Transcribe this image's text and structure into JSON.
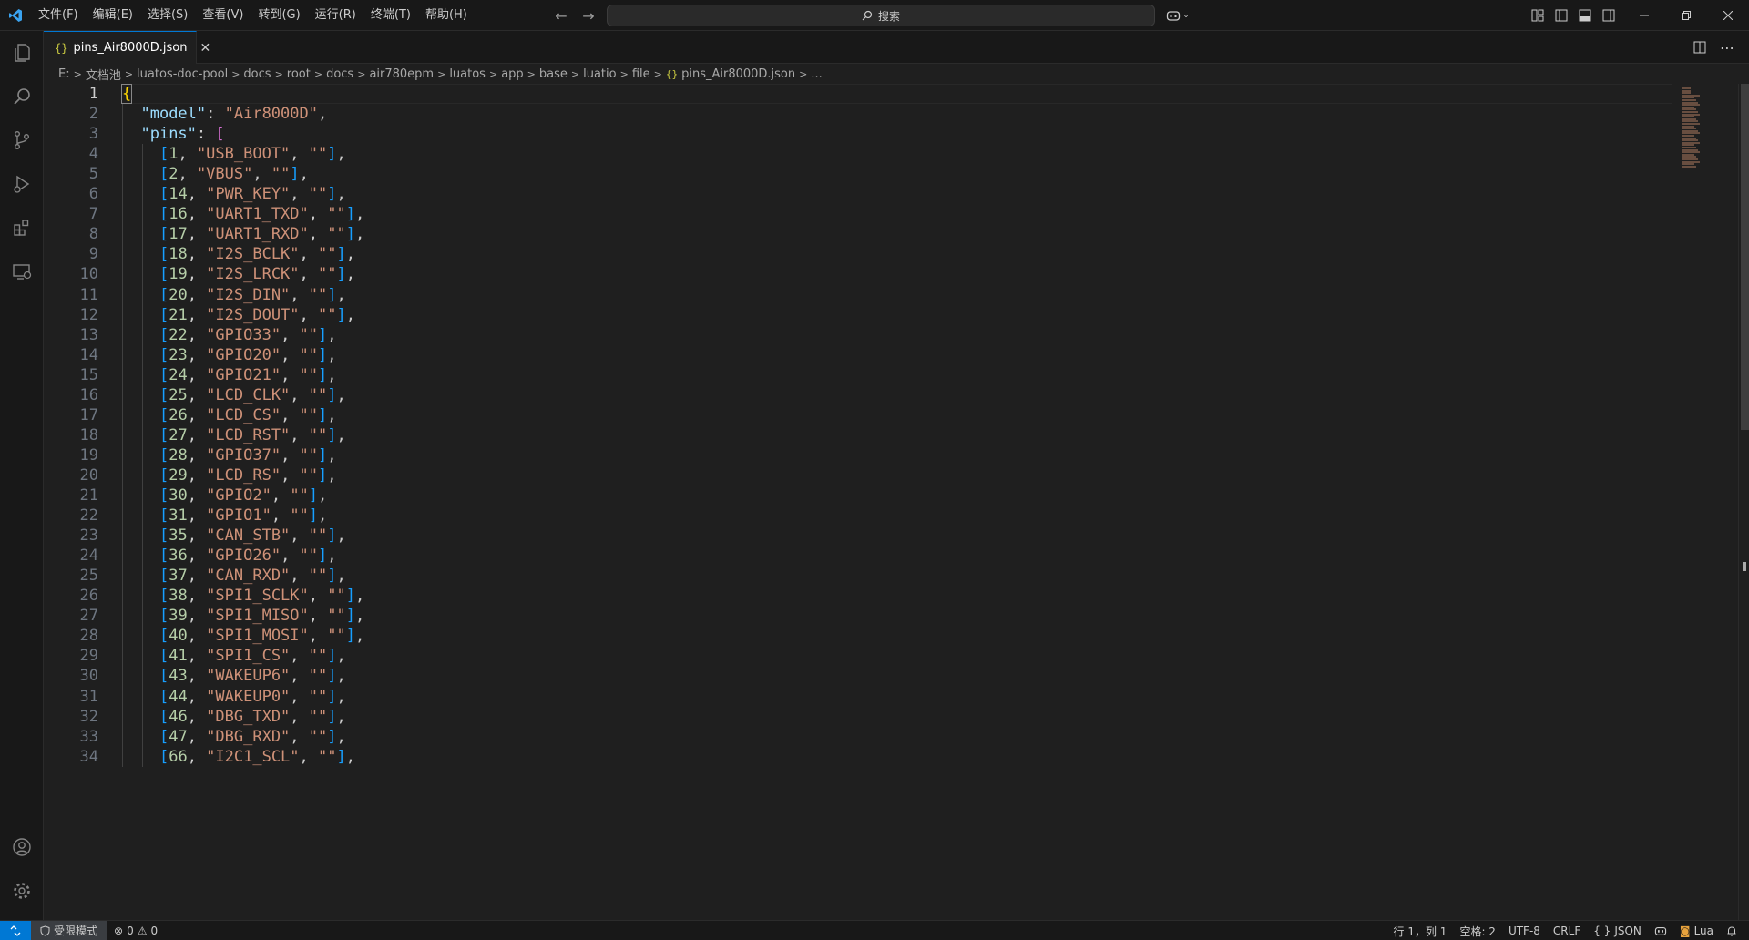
{
  "menu": [
    "文件(F)",
    "编辑(E)",
    "选择(S)",
    "查看(V)",
    "转到(G)",
    "运行(R)",
    "终端(T)",
    "帮助(H)"
  ],
  "search": {
    "label": "搜索"
  },
  "tab": {
    "title": "pins_Air8000D.json",
    "icon": "{}"
  },
  "breadcrumbs": [
    "E:",
    "文档池",
    "luatos-doc-pool",
    "docs",
    "root",
    "docs",
    "air780epm",
    "luatos",
    "app",
    "base",
    "luatio",
    "file",
    "pins_Air8000D.json",
    "..."
  ],
  "lines": [
    {
      "n": "1"
    },
    {
      "n": "2"
    },
    {
      "n": "3"
    },
    {
      "n": "4"
    },
    {
      "n": "5"
    },
    {
      "n": "6"
    },
    {
      "n": "7"
    },
    {
      "n": "8"
    },
    {
      "n": "9"
    },
    {
      "n": "10"
    },
    {
      "n": "11"
    },
    {
      "n": "12"
    },
    {
      "n": "13"
    },
    {
      "n": "14"
    },
    {
      "n": "15"
    },
    {
      "n": "16"
    },
    {
      "n": "17"
    },
    {
      "n": "18"
    },
    {
      "n": "19"
    },
    {
      "n": "20"
    },
    {
      "n": "21"
    },
    {
      "n": "22"
    },
    {
      "n": "23"
    },
    {
      "n": "24"
    },
    {
      "n": "25"
    },
    {
      "n": "26"
    },
    {
      "n": "27"
    },
    {
      "n": "28"
    },
    {
      "n": "29"
    },
    {
      "n": "30"
    },
    {
      "n": "31"
    },
    {
      "n": "32"
    },
    {
      "n": "33"
    },
    {
      "n": "34"
    }
  ],
  "code": {
    "model_key": "\"model\"",
    "model_value": "\"Air8000D\"",
    "pins_key": "\"pins\"",
    "pins": [
      [
        "1",
        "\"USB_BOOT\""
      ],
      [
        "2",
        "\"VBUS\""
      ],
      [
        "14",
        "\"PWR_KEY\""
      ],
      [
        "16",
        "\"UART1_TXD\""
      ],
      [
        "17",
        "\"UART1_RXD\""
      ],
      [
        "18",
        "\"I2S_BCLK\""
      ],
      [
        "19",
        "\"I2S_LRCK\""
      ],
      [
        "20",
        "\"I2S_DIN\""
      ],
      [
        "21",
        "\"I2S_DOUT\""
      ],
      [
        "22",
        "\"GPIO33\""
      ],
      [
        "23",
        "\"GPIO20\""
      ],
      [
        "24",
        "\"GPIO21\""
      ],
      [
        "25",
        "\"LCD_CLK\""
      ],
      [
        "26",
        "\"LCD_CS\""
      ],
      [
        "27",
        "\"LCD_RST\""
      ],
      [
        "28",
        "\"GPIO37\""
      ],
      [
        "29",
        "\"LCD_RS\""
      ],
      [
        "30",
        "\"GPIO2\""
      ],
      [
        "31",
        "\"GPIO1\""
      ],
      [
        "35",
        "\"CAN_STB\""
      ],
      [
        "36",
        "\"GPIO26\""
      ],
      [
        "37",
        "\"CAN_RXD\""
      ],
      [
        "38",
        "\"SPI1_SCLK\""
      ],
      [
        "39",
        "\"SPI1_MISO\""
      ],
      [
        "40",
        "\"SPI1_MOSI\""
      ],
      [
        "41",
        "\"SPI1_CS\""
      ],
      [
        "43",
        "\"WAKEUP6\""
      ],
      [
        "44",
        "\"WAKEUP0\""
      ],
      [
        "46",
        "\"DBG_TXD\""
      ],
      [
        "47",
        "\"DBG_RXD\""
      ],
      [
        "66",
        "\"I2C1_SCL\""
      ]
    ],
    "empty_str": "\"\""
  },
  "status": {
    "restricted": "受限模式",
    "errors": "0",
    "warnings": "0",
    "cursor": "行 1，列 1",
    "spaces": "空格: 2",
    "encoding": "UTF-8",
    "eol": "CRLF",
    "language": "JSON",
    "lua": "Lua"
  },
  "colors": {
    "accent": "#0078d4",
    "key": "#9cdcfe",
    "string": "#ce9178",
    "number": "#b5cea8"
  }
}
